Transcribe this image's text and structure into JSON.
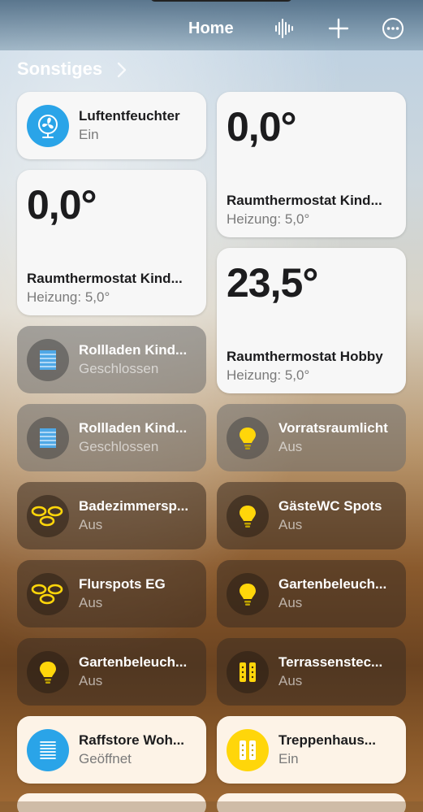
{
  "header": {
    "title": "Home",
    "icons": [
      "voice-intercom-icon",
      "add-icon",
      "more-icon"
    ]
  },
  "section": {
    "title": "Sonstiges"
  },
  "colors": {
    "fan_blue": "#2aa4e8",
    "bulb_yellow": "#ffd60a",
    "tile_on": "#f7f7f7",
    "tile_warm": "#fdf3e7"
  },
  "tiles": {
    "luftentfeuchter": {
      "name": "Luftentfeuchter",
      "state": "Ein",
      "icon": "fan-icon"
    },
    "thermo1": {
      "value": "0,0°",
      "name": "Raumthermostat Kind...",
      "state": "Heizung: 5,0°"
    },
    "thermo2": {
      "value": "0,0°",
      "name": "Raumthermostat Kind...",
      "state": "Heizung: 5,0°"
    },
    "thermo_hobby": {
      "value": "23,5°",
      "name": "Raumthermostat Hobby",
      "state": "Heizung: 5,0°"
    },
    "rollladen1": {
      "name": "Rollladen Kind...",
      "state": "Geschlossen",
      "icon": "blinds-icon"
    },
    "rollladen2": {
      "name": "Rollladen Kind...",
      "state": "Geschlossen",
      "icon": "blinds-icon"
    },
    "vorratsraum": {
      "name": "Vorratsraumlicht",
      "state": "Aus",
      "icon": "bulb-icon"
    },
    "badezimmer": {
      "name": "Badezimmersp...",
      "state": "Aus",
      "icon": "spots-icon"
    },
    "gaestewc": {
      "name": "GästeWC Spots",
      "state": "Aus",
      "icon": "bulb-icon"
    },
    "flurspots": {
      "name": "Flurspots EG",
      "state": "Aus",
      "icon": "spots-icon"
    },
    "garten1": {
      "name": "Gartenbeleuch...",
      "state": "Aus",
      "icon": "bulb-icon"
    },
    "garten2": {
      "name": "Gartenbeleuch...",
      "state": "Aus",
      "icon": "bulb-icon"
    },
    "terrasse": {
      "name": "Terrassenstec...",
      "state": "Aus",
      "icon": "power-strip-icon"
    },
    "raffstore": {
      "name": "Raffstore Woh...",
      "state": "Geöffnet",
      "icon": "raffstore-icon"
    },
    "treppenhaus": {
      "name": "Treppenhaus...",
      "state": "Ein",
      "icon": "power-strip-icon"
    }
  }
}
